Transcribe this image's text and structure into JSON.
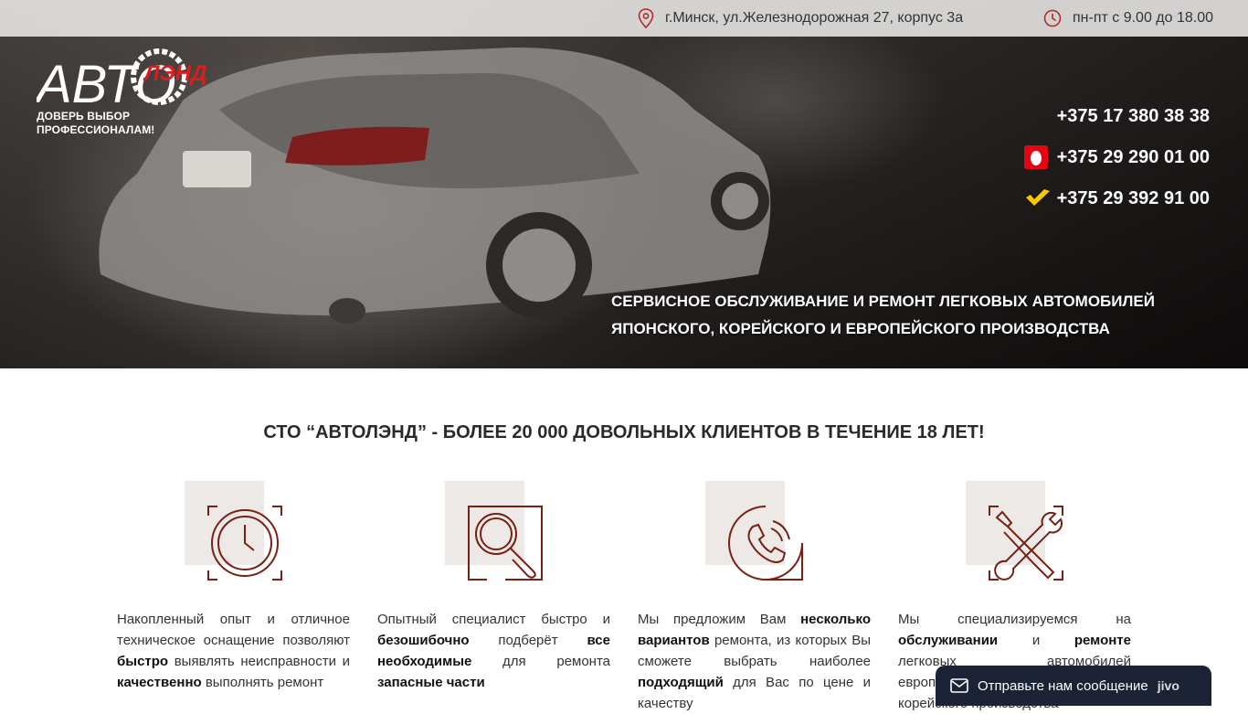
{
  "topbar": {
    "address": "г.Минск, ул.Железнодорожная 27, корпус 3а",
    "hours": "пн-пт с 9.00 до 18.00"
  },
  "logo": {
    "text_main": "АВТО",
    "text_brand": "ЛЭНД",
    "tagline_line1": "ДОВЕРЬ ВЫБОР",
    "tagline_line2": "ПРОФЕССИОНАЛАМ!"
  },
  "phones": [
    {
      "number": "+375 17 380 38 38",
      "operator": ""
    },
    {
      "number": "+375 29 290 01 00",
      "operator": "mts-icon"
    },
    {
      "number": "+375 29 392 91 00",
      "operator": "velcom-icon"
    }
  ],
  "hero": {
    "title": "СЕРВИСНОЕ ОБСЛУЖИВАНИЕ И РЕМОНТ ЛЕГКОВЫХ АВТОМОБИЛЕЙ ЯПОНСКОГО, КОРЕЙСКОГО И ЕВРОПЕЙСКОГО ПРОИЗВОДСТВА"
  },
  "headline": "СТО “АВТОЛЭНД” - БОЛЕЕ 20 000 ДОВОЛЬНЫХ КЛИЕНТОВ В ТЕЧЕНИЕ 18 ЛЕТ!",
  "features": [
    {
      "icon": "clock-icon",
      "parts": [
        {
          "t": "Накопленный опыт и отличное техническое оснащение позволяют ",
          "b": false
        },
        {
          "t": "быстро",
          "b": true
        },
        {
          "t": " выявлять неисправности и ",
          "b": false
        },
        {
          "t": "качественно",
          "b": true
        },
        {
          "t": " выполнять ремонт",
          "b": false
        }
      ]
    },
    {
      "icon": "magnifier-icon",
      "parts": [
        {
          "t": "Опытный специалист быстро и ",
          "b": false
        },
        {
          "t": "безошибочно",
          "b": true
        },
        {
          "t": " подберёт ",
          "b": false
        },
        {
          "t": "все необходимые",
          "b": true
        },
        {
          "t": " для ремонта ",
          "b": false
        },
        {
          "t": "запасные части",
          "b": true
        }
      ]
    },
    {
      "icon": "phone-call-icon",
      "parts": [
        {
          "t": "Мы предложим Вам ",
          "b": false
        },
        {
          "t": "несколько вариантов",
          "b": true
        },
        {
          "t": " ремонта, из которых Вы сможете выбрать наиболее ",
          "b": false
        },
        {
          "t": "подходящий",
          "b": true
        },
        {
          "t": " для Вас по цене и качеству",
          "b": false
        }
      ]
    },
    {
      "icon": "tools-icon",
      "parts": [
        {
          "t": "Мы специализируемся на ",
          "b": false
        },
        {
          "t": "обслуживании",
          "b": true
        },
        {
          "t": " и ",
          "b": false
        },
        {
          "t": "ремонте",
          "b": true
        },
        {
          "t": " легковых автомобилей европейского, японского и корейского производства",
          "b": false
        }
      ]
    }
  ],
  "chat": {
    "label": "Отправьте нам сообщение",
    "brand": "jivo"
  },
  "colors": {
    "accent": "#7a1f14",
    "logo_red": "#e01b1b",
    "chat_bg": "#1d2337"
  }
}
